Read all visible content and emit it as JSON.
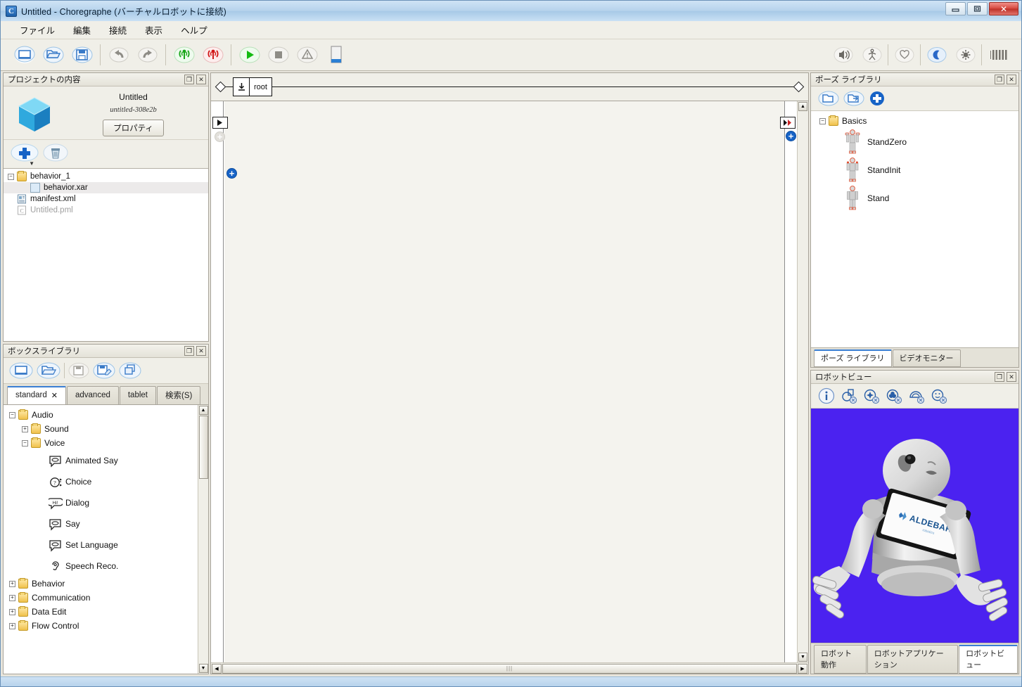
{
  "window": {
    "title": "Untitled - Choregraphe (バーチャルロボットに接続)",
    "app_icon": "C",
    "minimize_label": "—",
    "maximize_label": "❐",
    "close_label": "✕"
  },
  "menubar": {
    "items": [
      {
        "label": "ファイル",
        "name": "menu-file"
      },
      {
        "label": "編集",
        "name": "menu-edit"
      },
      {
        "label": "接続",
        "name": "menu-connection"
      },
      {
        "label": "表示",
        "name": "menu-view"
      },
      {
        "label": "ヘルプ",
        "name": "menu-help"
      }
    ]
  },
  "toolbar": {
    "left_icons": [
      {
        "name": "new-project-icon",
        "tip": "新規"
      },
      {
        "name": "open-project-icon",
        "tip": "開く"
      },
      {
        "name": "save-project-icon",
        "tip": "保存"
      },
      {
        "name": "undo-icon",
        "tip": "元に戻す"
      },
      {
        "name": "redo-icon",
        "tip": "やり直し"
      },
      {
        "name": "connect-icon",
        "tip": "接続"
      },
      {
        "name": "disconnect-icon",
        "tip": "切断"
      },
      {
        "name": "play-icon",
        "tip": "再生"
      },
      {
        "name": "stop-icon",
        "tip": "停止"
      },
      {
        "name": "debug-icon",
        "tip": "デバッグ"
      },
      {
        "name": "tablet-icon",
        "tip": "タブレット"
      }
    ],
    "right_icons": [
      {
        "name": "volume-icon",
        "tip": "音量"
      },
      {
        "name": "posture-icon",
        "tip": "姿勢"
      },
      {
        "name": "life-icon",
        "tip": "自律生活"
      },
      {
        "name": "rest-icon",
        "tip": "休止"
      },
      {
        "name": "wakeup-icon",
        "tip": "起動"
      },
      {
        "name": "battery-icon",
        "tip": "バッテリー"
      }
    ]
  },
  "project_panel": {
    "title": "プロジェクトの内容",
    "float_label": "❐",
    "close_label": "✕",
    "project_name": "Untitled",
    "project_id": "untitled-308e2b",
    "properties_button": "プロパティ",
    "add_button_name": "add-file-button",
    "delete_button_name": "delete-file-button",
    "tree": [
      {
        "label": "behavior_1",
        "indent": 0,
        "expander": "−",
        "icon": "folder",
        "selected": false,
        "dim": false
      },
      {
        "label": "behavior.xar",
        "indent": 1,
        "expander": "",
        "icon": "file",
        "selected": true,
        "dim": false
      },
      {
        "label": "manifest.xml",
        "indent": 0,
        "expander": "",
        "icon": "xml",
        "selected": false,
        "dim": false
      },
      {
        "label": "Untitled.pml",
        "indent": 0,
        "expander": "",
        "icon": "pml",
        "selected": false,
        "dim": true
      }
    ]
  },
  "box_library": {
    "title": "ボックスライブラリ",
    "float_label": "❐",
    "close_label": "✕",
    "tools": [
      {
        "name": "new-library-icon"
      },
      {
        "name": "open-library-icon"
      },
      {
        "name": "save-library-icon"
      },
      {
        "name": "save-as-library-icon"
      },
      {
        "name": "duplicate-library-icon"
      }
    ],
    "tabs": [
      {
        "label": "standard",
        "active": true,
        "closable": true
      },
      {
        "label": "advanced",
        "active": false,
        "closable": false
      },
      {
        "label": "tablet",
        "active": false,
        "closable": false
      },
      {
        "label": "検索(S)",
        "active": false,
        "closable": false
      }
    ],
    "tree": [
      {
        "label": "Audio",
        "indent": 0,
        "expander": "−",
        "icon": "folder"
      },
      {
        "label": "Sound",
        "indent": 1,
        "expander": "+",
        "icon": "folder"
      },
      {
        "label": "Voice",
        "indent": 1,
        "expander": "−",
        "icon": "folder"
      },
      {
        "label": "Animated Say",
        "indent": 3,
        "expander": "",
        "icon": "say"
      },
      {
        "label": "Choice",
        "indent": 3,
        "expander": "",
        "icon": "choice"
      },
      {
        "label": "Dialog",
        "indent": 3,
        "expander": "",
        "icon": "dialog"
      },
      {
        "label": "Say",
        "indent": 3,
        "expander": "",
        "icon": "say"
      },
      {
        "label": "Set Language",
        "indent": 3,
        "expander": "",
        "icon": "say"
      },
      {
        "label": "Speech Reco.",
        "indent": 3,
        "expander": "",
        "icon": "ear"
      },
      {
        "label": "Behavior",
        "indent": 0,
        "expander": "+",
        "icon": "folder"
      },
      {
        "label": "Communication",
        "indent": 0,
        "expander": "+",
        "icon": "folder"
      },
      {
        "label": "Data Edit",
        "indent": 0,
        "expander": "+",
        "icon": "folder"
      },
      {
        "label": "Flow Control",
        "indent": 0,
        "expander": "+",
        "icon": "folder"
      }
    ]
  },
  "flow": {
    "breadcrumb_root_label": "root",
    "scroll_up_label": "▲",
    "scroll_down_label": "▼",
    "scroll_left_label": "◀",
    "scroll_right_label": "▶",
    "input_port_name": "flow-input-port",
    "output_port_name": "flow-output-port"
  },
  "pose_library": {
    "title": "ポーズ ライブラリ",
    "float_label": "❐",
    "close_label": "✕",
    "tools": [
      {
        "name": "open-pose-library-icon"
      },
      {
        "name": "import-pose-icon"
      },
      {
        "name": "add-pose-icon"
      }
    ],
    "tree": [
      {
        "label": "Basics",
        "type": "folder",
        "expander": "−"
      },
      {
        "label": "StandZero",
        "type": "pose",
        "expander": ""
      },
      {
        "label": "StandInit",
        "type": "pose",
        "expander": ""
      },
      {
        "label": "Stand",
        "type": "pose",
        "expander": ""
      }
    ],
    "tabs": [
      {
        "label": "ポーズ ライブラリ",
        "active": true
      },
      {
        "label": "ビデオモニター",
        "active": false
      }
    ]
  },
  "robot_view": {
    "title": "ロボットビュー",
    "float_label": "❐",
    "close_label": "✕",
    "tools": [
      {
        "name": "info-icon"
      },
      {
        "name": "show-joints-icon"
      },
      {
        "name": "show-sensors-icon"
      },
      {
        "name": "show-actuators-icon"
      },
      {
        "name": "show-leds-icon"
      },
      {
        "name": "show-camera-icon"
      }
    ],
    "background_color": "#4b22f0",
    "robot_label": "ALDEBARAN",
    "tabs": [
      {
        "label": "ロボット動作",
        "active": false
      },
      {
        "label": "ロボットアプリケーション",
        "active": false
      },
      {
        "label": "ロボットビュー",
        "active": true
      }
    ]
  }
}
